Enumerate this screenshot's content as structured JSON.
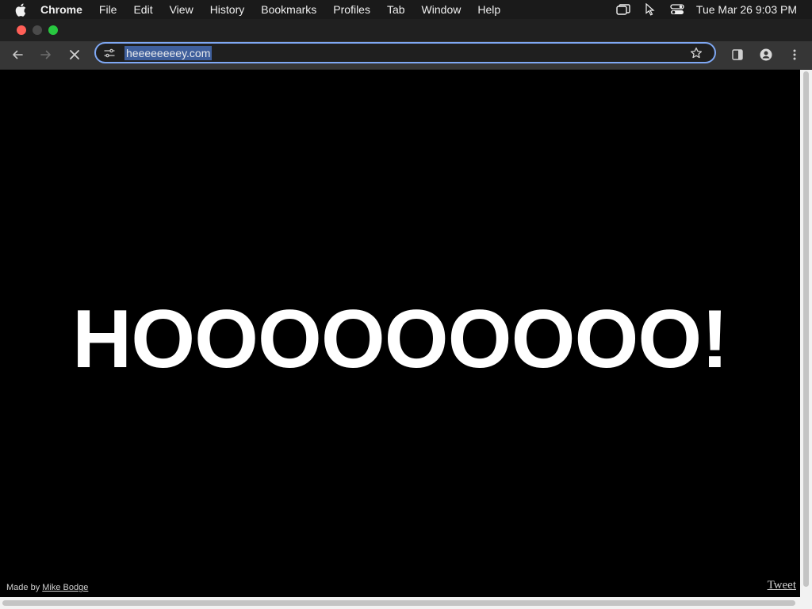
{
  "menubar": {
    "apple_icon": "apple-icon",
    "app_name": "Chrome",
    "items": [
      "File",
      "Edit",
      "View",
      "History",
      "Bookmarks",
      "Profiles",
      "Tab",
      "Window",
      "Help"
    ],
    "tray_icons": [
      "screen-mirroring-icon",
      "cursor-icon",
      "control-center-icon"
    ],
    "clock": "Tue Mar 26  9:03 PM"
  },
  "toolbar": {
    "back_icon": "back-arrow-icon",
    "forward_icon": "forward-arrow-icon",
    "stop_icon": "stop-loading-icon",
    "site_info_icon": "tune-icon",
    "url": "heeeeeeeey.com",
    "bookmark_icon": "star-icon",
    "side_panel_icon": "side-panel-icon",
    "profile_icon": "profile-icon",
    "menu_icon": "kebab-menu-icon"
  },
  "page": {
    "hero_text": "HOOOOOOOOO!",
    "credit_prefix": "Made by",
    "credit_link": "Mike Bodge",
    "tweet_link": "Tweet"
  },
  "colors": {
    "page_background": "#000000",
    "hero_text": "#ffffff",
    "omnibox_focus": "#7fa8f4",
    "url_selection": "#3f5f9c"
  }
}
